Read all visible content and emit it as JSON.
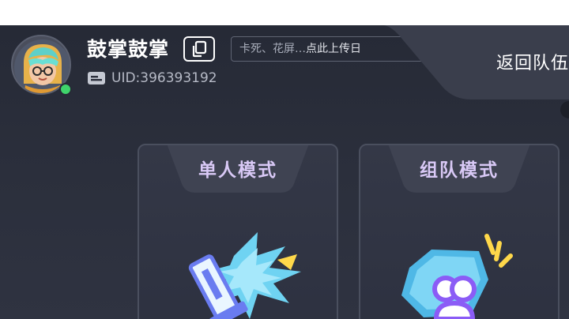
{
  "profile": {
    "nickname": "鼓掌鼓掌",
    "uid_text": "UID:396393192",
    "status": "online",
    "avatar_icon": "avatar-character-icon",
    "copy_icon": "copy-icon",
    "id_card_icon": "id-card-icon"
  },
  "feedback": {
    "hint": "卡死、花屏…",
    "action": "点此上传日"
  },
  "return_banner": {
    "label": "返回队伍"
  },
  "modes": [
    {
      "title": "单人模式",
      "icon": "sword-burst-icon"
    },
    {
      "title": "组队模式",
      "icon": "team-gem-icon"
    }
  ],
  "colors": {
    "background": "#2b2f3c",
    "online": "#3fd46b",
    "card_title": "#d9c9f6",
    "accent_blue": "#5ac8f0",
    "accent_yellow": "#ffd84a",
    "accent_purple": "#8b5cf6"
  }
}
